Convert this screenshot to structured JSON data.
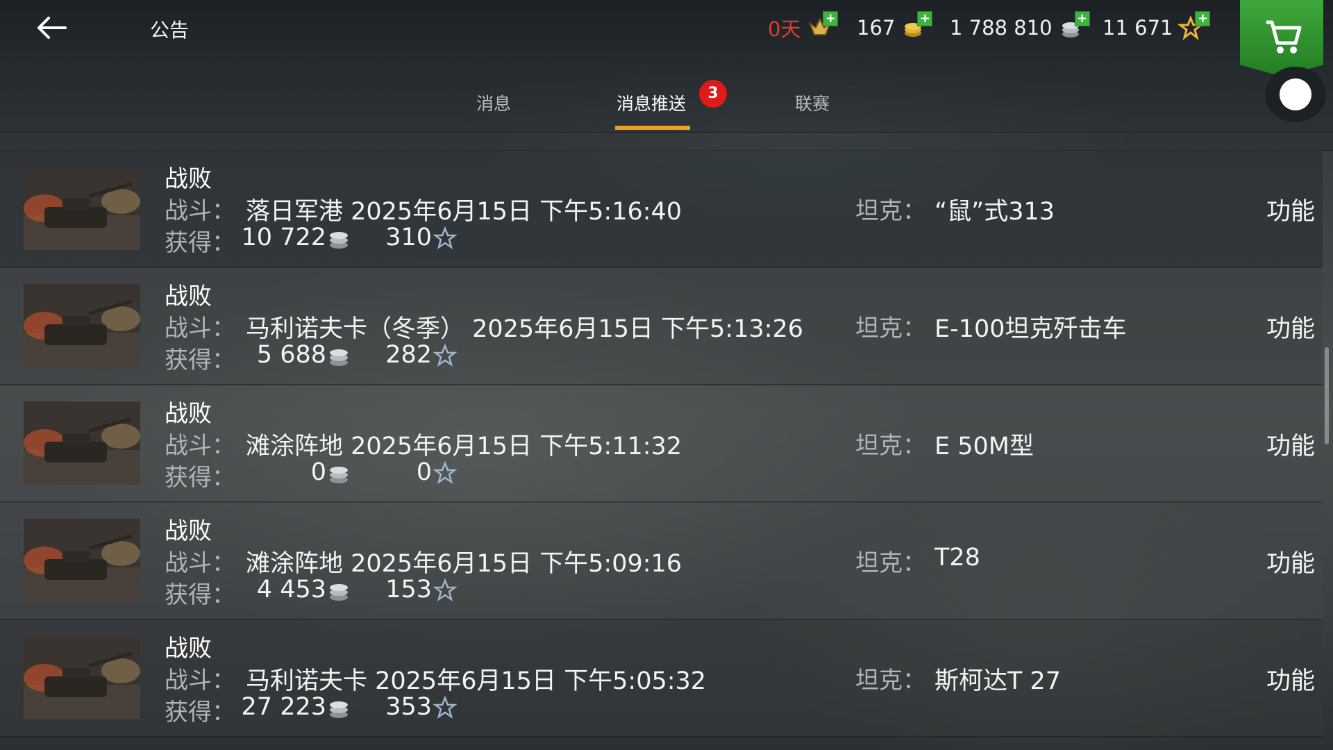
{
  "header": {
    "title": "公告",
    "premium": "0天",
    "gold": "167",
    "credits": "1 788 810",
    "free_xp": "11 671"
  },
  "tabs": [
    {
      "label": "消息"
    },
    {
      "label": "消息推送",
      "badge": "3"
    },
    {
      "label": "联赛"
    }
  ],
  "labels": {
    "battle": "战斗：",
    "earned": "获得：",
    "tank": "坦克：",
    "function": "功能"
  },
  "messages": [
    {
      "result": "战败",
      "battle": "落日军港 2025年6月15日 下午5:16:40",
      "credits": "10 722",
      "xp": "310",
      "tank": "“鼠”式313"
    },
    {
      "result": "战败",
      "battle": "马利诺夫卡（冬季） 2025年6月15日 下午5:13:26",
      "credits": "5 688",
      "xp": "282",
      "tank": "E-100坦克歼击车"
    },
    {
      "result": "战败",
      "battle": "滩涂阵地 2025年6月15日 下午5:11:32",
      "credits": "0",
      "xp": "0",
      "tank": "E 50M型"
    },
    {
      "result": "战败",
      "battle": "滩涂阵地 2025年6月15日 下午5:09:16",
      "credits": "4 453",
      "xp": "153",
      "tank": "T28"
    },
    {
      "result": "战败",
      "battle": "马利诺夫卡 2025年6月15日 下午5:05:32",
      "credits": "27 223",
      "xp": "353",
      "tank": "斯柯达T 27"
    }
  ],
  "colors": {
    "accent": "#f39c1f",
    "badge": "#e01a1a",
    "premium": "#e53b2c",
    "shop": "#3fa83c"
  }
}
